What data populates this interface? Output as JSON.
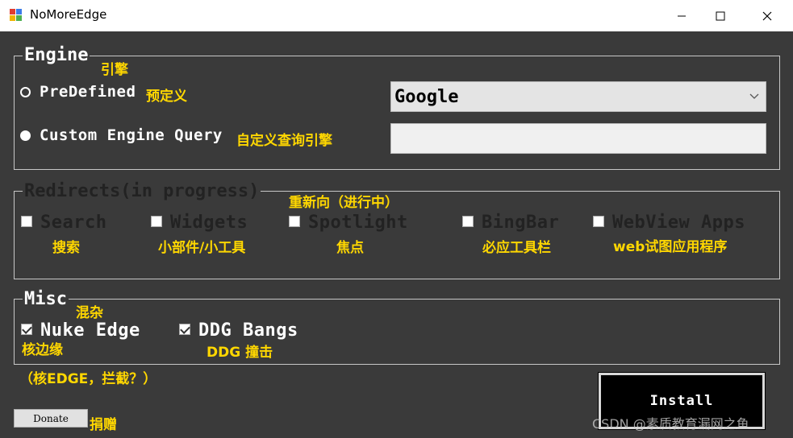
{
  "window": {
    "title": "NoMoreEdge"
  },
  "engine": {
    "legend": "Engine",
    "legend_note": "引擎",
    "predefined_label": "PreDefined",
    "predefined_note": "预定义",
    "custom_label": "Custom Engine Query",
    "custom_note": "自定义查询引擎",
    "selected_engine": "Google",
    "custom_query_value": ""
  },
  "redirects": {
    "legend": "Redirects(in progress)",
    "legend_note": "重新向（进行中）",
    "items": [
      {
        "label": "Search",
        "note": "搜索",
        "checked": false
      },
      {
        "label": "Widgets",
        "note": "小部件/小工具",
        "checked": false
      },
      {
        "label": "Spotlight",
        "note": "焦点",
        "checked": false
      },
      {
        "label": "BingBar",
        "note": "必应工具栏",
        "checked": false
      },
      {
        "label": "WebView Apps",
        "note": "web试图应用程序",
        "checked": false
      }
    ]
  },
  "misc": {
    "legend": "Misc",
    "legend_note": "混杂",
    "items": [
      {
        "label": "Nuke Edge",
        "note": "核边缘",
        "checked": true
      },
      {
        "label": "DDG Bangs",
        "note": "DDG 撞击",
        "checked": true
      }
    ],
    "footnote": "（核EDGE，拦截？）"
  },
  "buttons": {
    "install": "Install",
    "donate": "Donate",
    "donate_note": "捐赠"
  },
  "watermark": "CSDN @素质教育漏网之鱼",
  "colors": {
    "background": "#3a3a3a",
    "annotation": "#ffd700",
    "group_border": "#c8c8c8"
  }
}
